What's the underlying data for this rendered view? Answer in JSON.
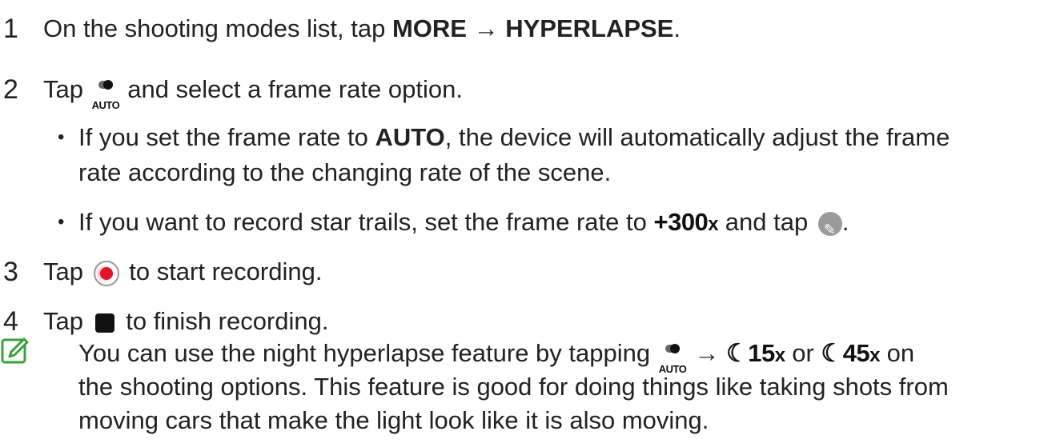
{
  "steps": [
    {
      "num": "1",
      "pre": "On the shooting modes list, tap ",
      "b1": "MORE",
      "arrow": " → ",
      "b2": "HYPERLAPSE",
      "post": "."
    },
    {
      "num": "2",
      "pre": "Tap ",
      "post": " and select a frame rate option."
    },
    {
      "num": "3",
      "pre": "Tap ",
      "post": " to start recording."
    },
    {
      "num": "4",
      "pre": "Tap ",
      "post": " to finish recording."
    }
  ],
  "bullets": [
    {
      "line1_pre": "If you set the frame rate to ",
      "line1_bold": "AUTO",
      "line1_post": ", the device will automatically adjust the frame",
      "line2": "rate according to the changing rate of the scene."
    },
    {
      "pre": "If you want to record star trails, set the frame rate to ",
      "post": " and tap ",
      "end": "."
    }
  ],
  "icons": {
    "auto_label": "AUTO",
    "star_rate": "+300",
    "rate_15": "15",
    "rate_45": "45",
    "rate_x": "x",
    "moon": "☾",
    "colors": {
      "record": "#e3142b",
      "note_green": "#3aa13a"
    }
  },
  "note": {
    "line1_pre": "You can use the night hyperlapse feature by tapping ",
    "arrow": " → ",
    "or": " or ",
    "line1_post": " on",
    "line2": "the shooting options. This feature is good for doing things like taking shots from",
    "line3": "moving cars that make the light look like it is also moving."
  }
}
